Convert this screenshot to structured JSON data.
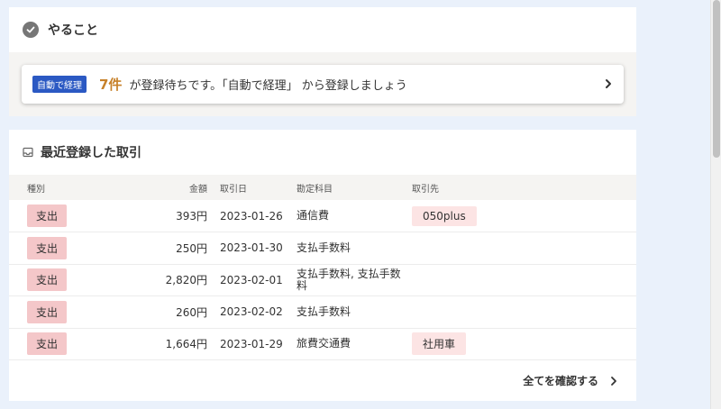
{
  "todo": {
    "title": "やること",
    "card": {
      "badge": "自動で経理",
      "count": "7件",
      "message": "が登録待ちです。「自動で経理」 から登録しましょう"
    }
  },
  "recent": {
    "title": "最近登録した取引",
    "columns": {
      "type": "種別",
      "amount": "金額",
      "date": "取引日",
      "account": "勘定科目",
      "partner": "取引先"
    },
    "rows": [
      {
        "type": "支出",
        "amount": "393円",
        "date": "2023-01-26",
        "account": "通信費",
        "partner": "050plus"
      },
      {
        "type": "支出",
        "amount": "250円",
        "date": "2023-01-30",
        "account": "支払手数料",
        "partner": ""
      },
      {
        "type": "支出",
        "amount": "2,820円",
        "date": "2023-02-01",
        "account": "支払手数料, 支払手数料",
        "partner": ""
      },
      {
        "type": "支出",
        "amount": "260円",
        "date": "2023-02-02",
        "account": "支払手数料",
        "partner": ""
      },
      {
        "type": "支出",
        "amount": "1,664円",
        "date": "2023-01-29",
        "account": "旅費交通費",
        "partner": "社用車"
      }
    ],
    "view_all": "全てを確認する"
  },
  "colors": {
    "badge_blue": "#2b59c3",
    "count_orange": "#c7812a",
    "expense_pink": "#f4c7c9",
    "partner_pink": "#fce4e4",
    "page_bg": "#eaf1fb"
  },
  "icons": {
    "todo": "check-circle-icon",
    "recent": "inbox-icon",
    "card_arrow": "chevron-right-icon",
    "view_all_arrow": "chevron-right-icon"
  }
}
